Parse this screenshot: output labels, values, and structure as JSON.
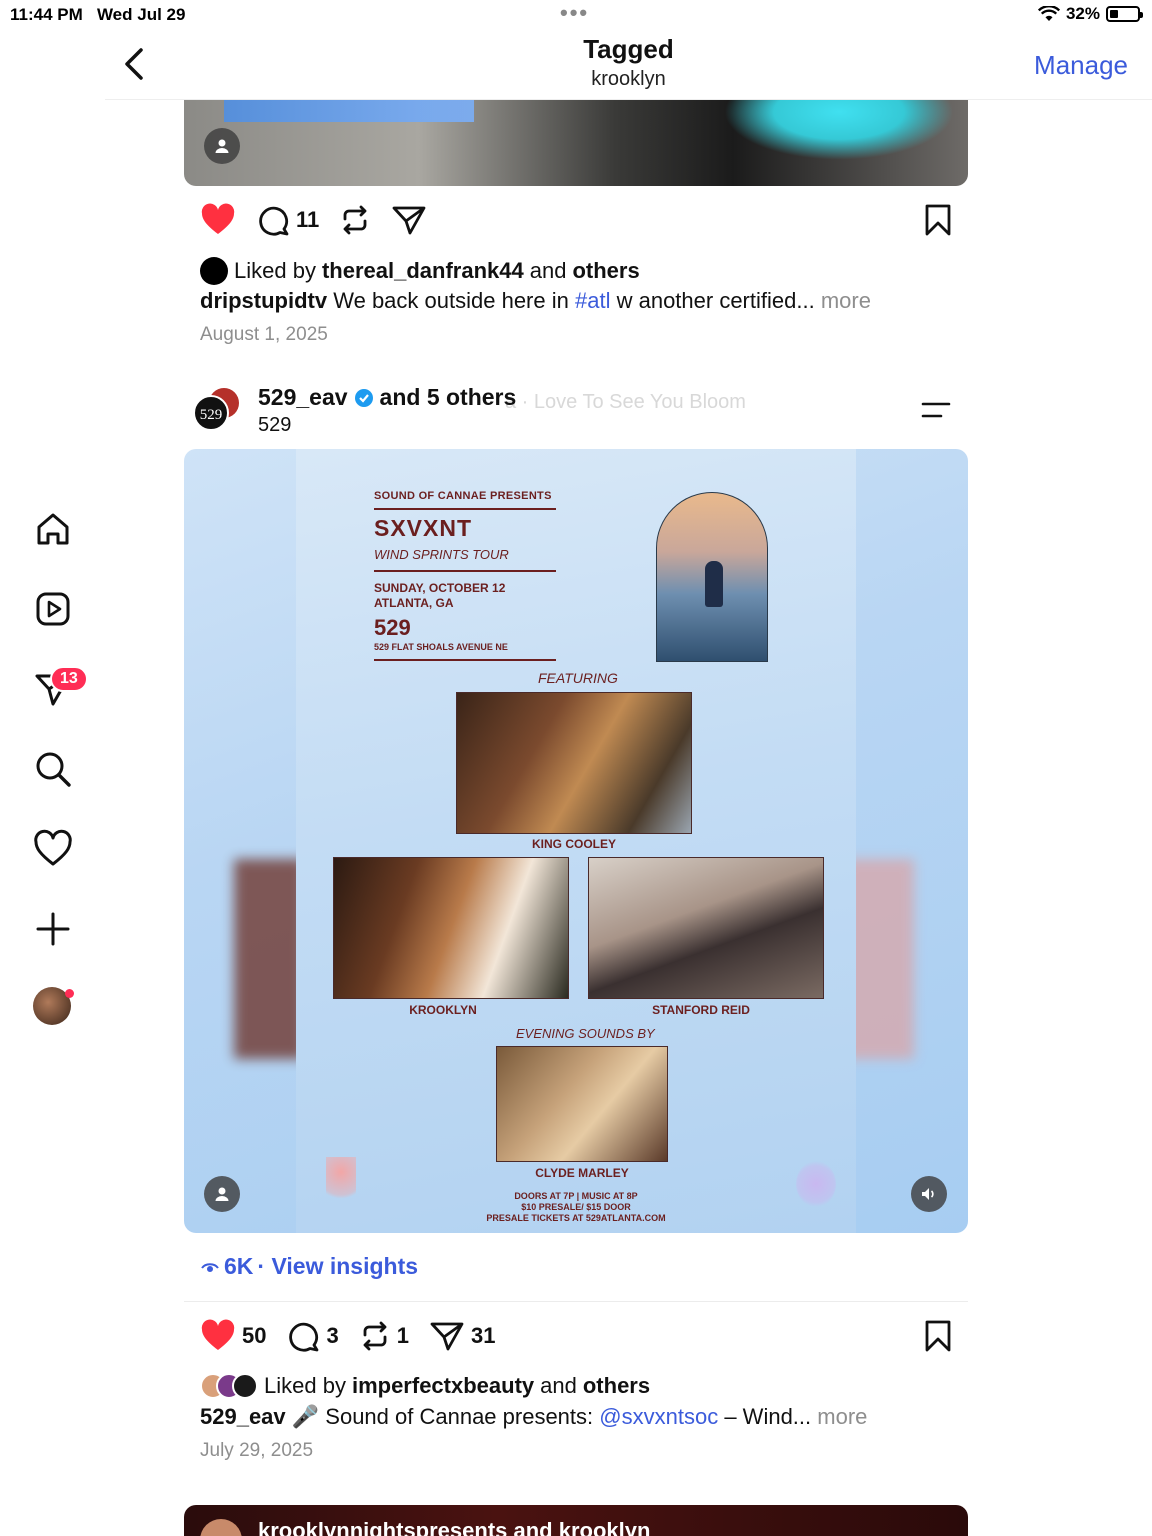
{
  "status_bar": {
    "time": "11:44 PM",
    "date": "Wed Jul 29",
    "battery": "32%",
    "battery_level": 0.32
  },
  "header": {
    "title": "Tagged",
    "subtitle": "krooklyn",
    "manage": "Manage"
  },
  "sidebar": {
    "messages_badge": "13"
  },
  "post1": {
    "comments": "11",
    "liked_prefix": "Liked by",
    "liked_user": "thereal_danfrank44",
    "liked_and": "and",
    "liked_others": "others",
    "caption_user": "dripstupidtv",
    "caption_before": "We back outside here in",
    "caption_tag": "#atl",
    "caption_after": "w another certified...",
    "more": "more",
    "date": "August 1, 2025"
  },
  "post2": {
    "user": "529_eav",
    "and_others": "and 5 others",
    "music_ghost": "a · Love To See You Bloom",
    "location": "529",
    "flyer": {
      "presents": "SOUND OF CANNAE PRESENTS",
      "artist": "SXVXNT",
      "tour": "WIND SPRINTS TOUR",
      "date_line1": "SUNDAY, OCTOBER 12",
      "date_line2": "ATLANTA, GA",
      "venue": "529",
      "address": "529 FLAT SHOALS AVENUE NE",
      "featuring": "FEATURING",
      "act1": "KING COOLEY",
      "act2": "KROOKLYN",
      "act3": "STANFORD REID",
      "evening": "EVENING SOUNDS BY",
      "act4": "CLYDE MARLEY",
      "foot1": "DOORS AT 7P | MUSIC AT 8P",
      "foot2": "$10 PRESALE/ $15 DOOR",
      "foot3": "PRESALE TICKETS AT 529ATLANTA.COM"
    },
    "views": "6K",
    "insights": "· View insights",
    "likes": "50",
    "comments": "3",
    "reposts": "1",
    "shares": "31",
    "liked_prefix": "Liked by",
    "liked_user": "imperfectxbeauty",
    "liked_and": "and",
    "liked_others": "others",
    "caption_user": "529_eav",
    "caption_before": "🎤 Sound of Cannae presents:",
    "caption_tag": "@sxvxntsoc",
    "caption_after": "– Wind...",
    "more": "more",
    "date": "July 29, 2025"
  },
  "post3": {
    "header_text": "krooklynnightspresents and krooklyn"
  }
}
